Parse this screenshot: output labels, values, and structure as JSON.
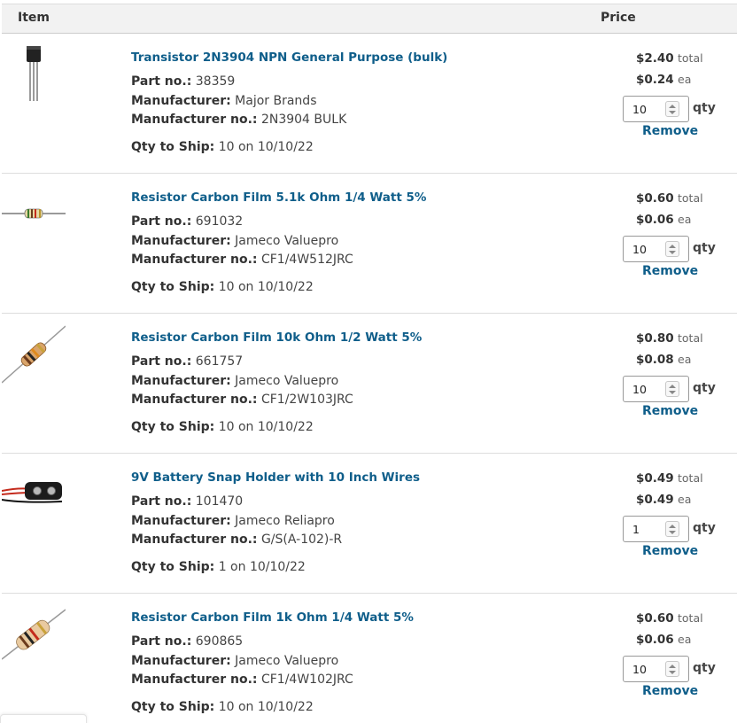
{
  "header": {
    "item_label": "Item",
    "price_label": "Price"
  },
  "labels": {
    "part_no": "Part no.:",
    "manufacturer": "Manufacturer:",
    "manufacturer_no": "Manufacturer no.:",
    "qty_to_ship": "Qty to Ship:",
    "total_unit": "total",
    "ea_unit": "ea",
    "qty": "qty",
    "remove": "Remove"
  },
  "items": [
    {
      "title": "Transistor 2N3904 NPN General Purpose (bulk)",
      "image_icon": "transistor-image",
      "part_no": "38359",
      "manufacturer": "Major Brands",
      "manufacturer_no": "2N3904 BULK",
      "qty_to_ship": "10 on 10/10/22",
      "total": "$2.40",
      "each": "$0.24",
      "qty": "10"
    },
    {
      "title": "Resistor Carbon Film 5.1k Ohm 1/4 Watt 5%",
      "image_icon": "resistor-image",
      "part_no": "691032",
      "manufacturer": "Jameco Valuepro",
      "manufacturer_no": "CF1/4W512JRC",
      "qty_to_ship": "10 on 10/10/22",
      "total": "$0.60",
      "each": "$0.06",
      "qty": "10"
    },
    {
      "title": "Resistor Carbon Film 10k Ohm 1/2 Watt 5%",
      "image_icon": "resistor-image",
      "part_no": "661757",
      "manufacturer": "Jameco Valuepro",
      "manufacturer_no": "CF1/2W103JRC",
      "qty_to_ship": "10 on 10/10/22",
      "total": "$0.80",
      "each": "$0.08",
      "qty": "10"
    },
    {
      "title": "9V Battery Snap Holder with 10 Inch Wires",
      "image_icon": "battery-snap-image",
      "part_no": "101470",
      "manufacturer": "Jameco Reliapro",
      "manufacturer_no": "G/S(A-102)-R",
      "qty_to_ship": "1 on 10/10/22",
      "total": "$0.49",
      "each": "$0.49",
      "qty": "1"
    },
    {
      "title": "Resistor Carbon Film 1k Ohm 1/4 Watt 5%",
      "image_icon": "resistor-image",
      "part_no": "690865",
      "manufacturer": "Jameco Valuepro",
      "manufacturer_no": "CF1/4W102JRC",
      "qty_to_ship": "10 on 10/10/22",
      "total": "$0.60",
      "each": "$0.06",
      "qty": "10"
    }
  ],
  "colors": {
    "link": "#0f5e8a",
    "header_bg": "#f2f2f2",
    "divider": "#dddddd"
  }
}
